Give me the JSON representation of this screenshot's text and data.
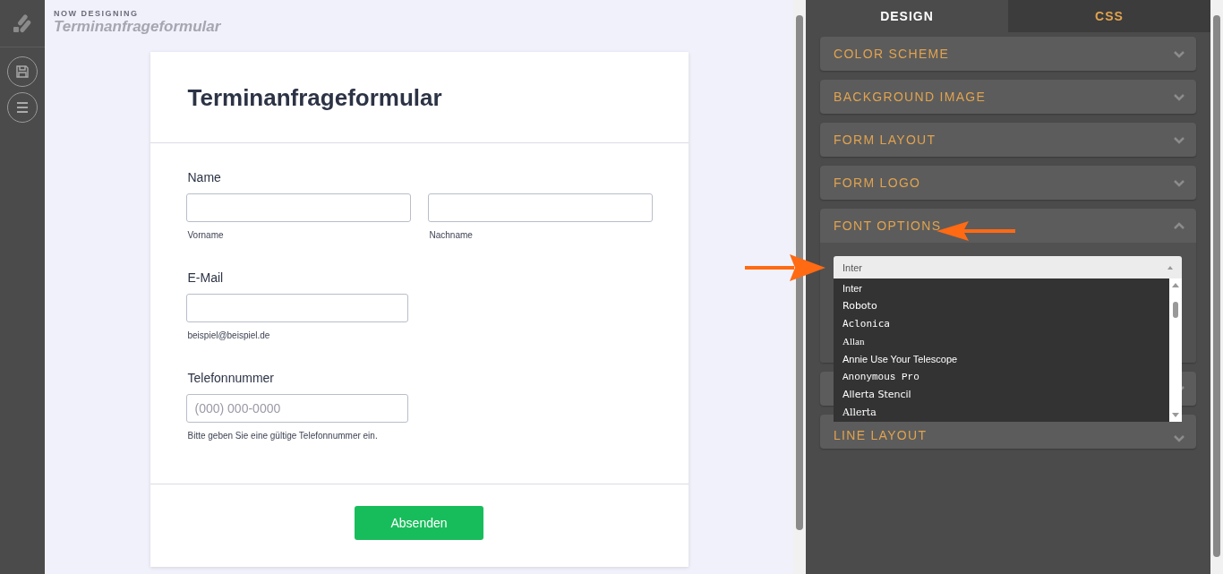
{
  "header": {
    "eyebrow": "NOW DESIGNING",
    "title": "Terminanfrageformular"
  },
  "form": {
    "title": "Terminanfrageformular",
    "fields": [
      {
        "kind": "name",
        "label": "Name",
        "subs": [
          "Vorname",
          "Nachname"
        ]
      },
      {
        "kind": "email",
        "label": "E-Mail",
        "hint": "beispiel@beispiel.de"
      },
      {
        "kind": "phone",
        "label": "Telefonnummer",
        "placeholder": "(000) 000-0000",
        "hint": "Bitte geben Sie eine gültige Telefonnummer ein."
      }
    ],
    "submit": "Absenden"
  },
  "tabs": [
    {
      "label": "DESIGN",
      "selected": true
    },
    {
      "label": "CSS",
      "selected": false
    }
  ],
  "sections": [
    {
      "label": "COLOR SCHEME",
      "expanded": false
    },
    {
      "label": "BACKGROUND IMAGE",
      "expanded": false
    },
    {
      "label": "FORM LAYOUT",
      "expanded": false
    },
    {
      "label": "FORM LOGO",
      "expanded": false
    },
    {
      "label": "FONT OPTIONS",
      "expanded": true
    },
    {
      "expanded": false
    },
    {
      "label": "LINE LAYOUT",
      "expanded": false
    }
  ],
  "font_select": {
    "value": "Inter",
    "options": [
      "Inter",
      "Roboto",
      "Aclonica",
      "Allan",
      "Annie Use Your Telescope",
      "Anonymous Pro",
      "Allerta Stencil",
      "Allerta"
    ]
  }
}
